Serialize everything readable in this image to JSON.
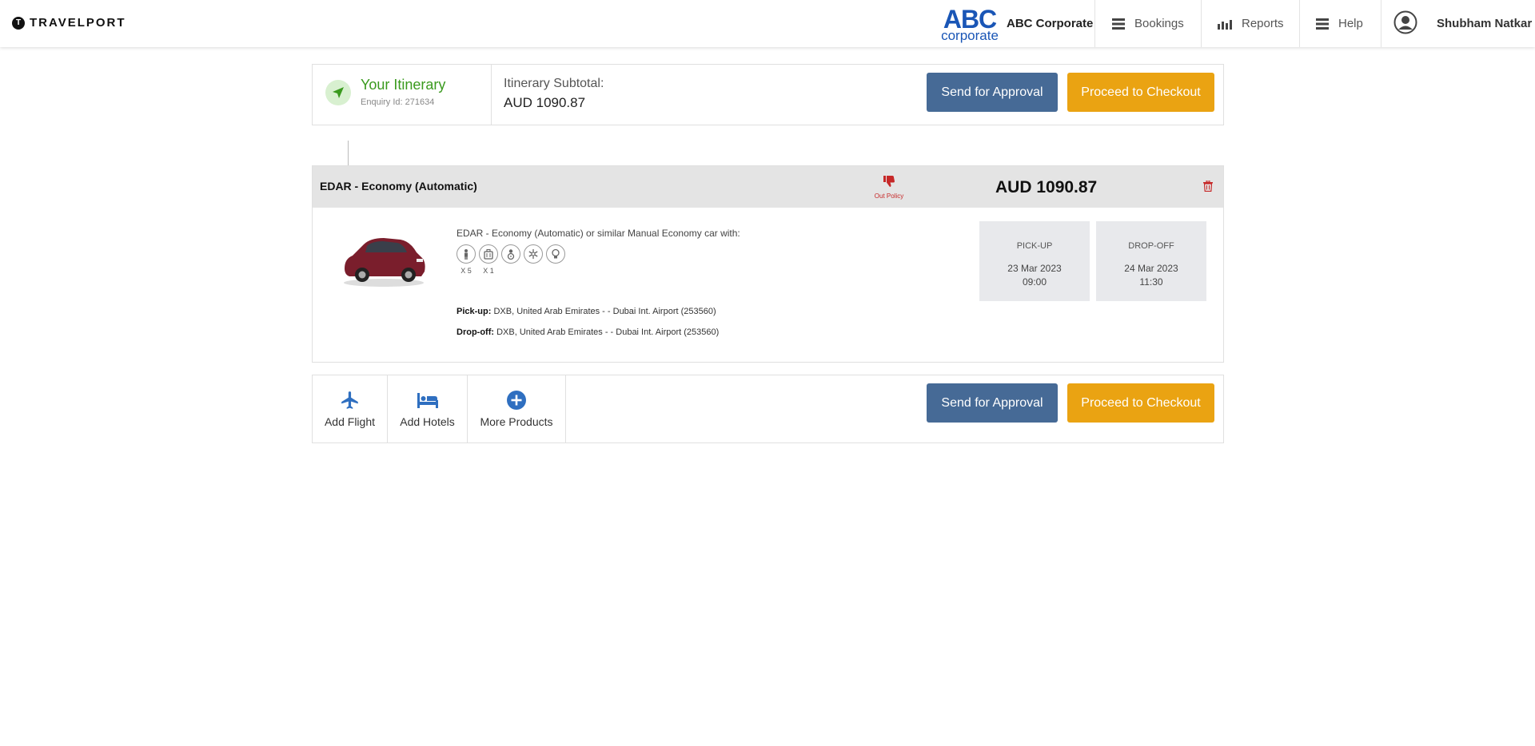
{
  "header": {
    "brand": "TRAVELPORT",
    "brand_mark": "T",
    "corp_logo_top": "ABC",
    "corp_logo_bottom": "corporate",
    "corp_name": "ABC Corporate",
    "nav": {
      "bookings": "Bookings",
      "reports": "Reports",
      "help": "Help"
    },
    "user_name": "Shubham Natkar"
  },
  "itinerary": {
    "title": "Your Itinerary",
    "enquiry": "Enquiry Id: 271634",
    "subtotal_label": "Itinerary Subtotal:",
    "subtotal_amount": "AUD  1090.87",
    "send_approval": "Send for Approval",
    "checkout": "Proceed to Checkout"
  },
  "car": {
    "title": "EDAR - Economy (Automatic)",
    "policy_label": "Out Policy",
    "price": "AUD 1090.87",
    "description": "EDAR - Economy (Automatic) or similar Manual Economy car with:",
    "features": [
      {
        "icon": "passenger-icon",
        "count": "X 5"
      },
      {
        "icon": "luggage-icon",
        "count": "X 1"
      },
      {
        "icon": "driver-icon",
        "count": ""
      },
      {
        "icon": "air-conditioning-icon",
        "count": ""
      },
      {
        "icon": "fuel-icon",
        "count": ""
      }
    ],
    "pickup_label": "Pick-up:",
    "pickup_location": " DXB, United Arab Emirates - - Dubai Int. Airport (253560)",
    "dropoff_label": "Drop-off:",
    "dropoff_location": " DXB, United Arab Emirates - - Dubai Int. Airport (253560)",
    "pickup_box": {
      "label": "PICK-UP",
      "date": "23 Mar 2023",
      "time": "09:00"
    },
    "dropoff_box": {
      "label": "DROP-OFF",
      "date": "24 Mar 2023",
      "time": "11:30"
    }
  },
  "actions": {
    "add_flight": "Add Flight",
    "add_hotels": "Add Hotels",
    "more_products": "More Products",
    "send_approval": "Send for Approval",
    "checkout": "Proceed to Checkout"
  },
  "colors": {
    "approval": "#466a96",
    "checkout": "#eaa312",
    "itinerary_green": "#3a9a1e",
    "policy_red": "#c62828",
    "link_blue": "#2f6fc0"
  }
}
